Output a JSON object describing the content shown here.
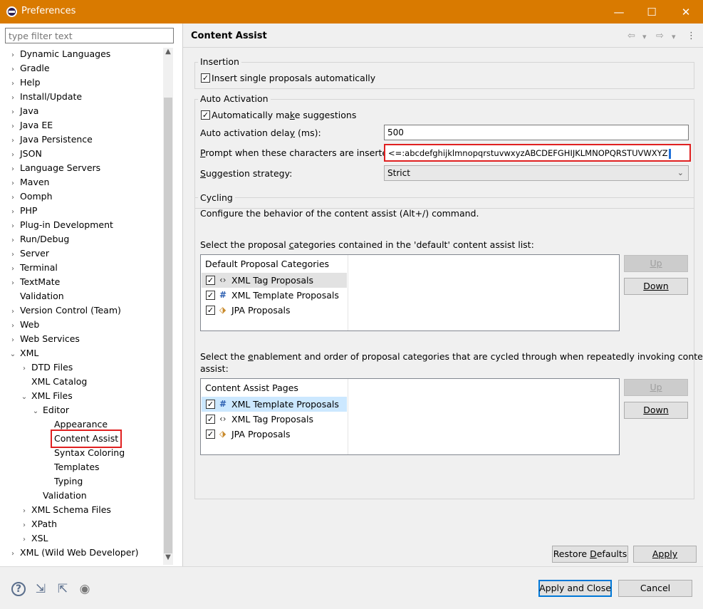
{
  "window": {
    "title": "Preferences",
    "controls": {
      "minimize": "—",
      "maximize": "☐",
      "close": "✕"
    }
  },
  "sidebar": {
    "filter_placeholder": "type filter text",
    "items": [
      {
        "label": "Dynamic Languages",
        "twisty": "›"
      },
      {
        "label": "Gradle",
        "twisty": "›"
      },
      {
        "label": "Help",
        "twisty": "›"
      },
      {
        "label": "Install/Update",
        "twisty": "›"
      },
      {
        "label": "Java",
        "twisty": "›"
      },
      {
        "label": "Java EE",
        "twisty": "›"
      },
      {
        "label": "Java Persistence",
        "twisty": "›"
      },
      {
        "label": "JSON",
        "twisty": "›"
      },
      {
        "label": "Language Servers",
        "twisty": "›"
      },
      {
        "label": "Maven",
        "twisty": "›"
      },
      {
        "label": "Oomph",
        "twisty": "›"
      },
      {
        "label": "PHP",
        "twisty": "›"
      },
      {
        "label": "Plug-in Development",
        "twisty": "›"
      },
      {
        "label": "Run/Debug",
        "twisty": "›"
      },
      {
        "label": "Server",
        "twisty": "›"
      },
      {
        "label": "Terminal",
        "twisty": "›"
      },
      {
        "label": "TextMate",
        "twisty": "›"
      },
      {
        "label": "Validation",
        "twisty": ""
      },
      {
        "label": "Version Control (Team)",
        "twisty": "›"
      },
      {
        "label": "Web",
        "twisty": "›"
      },
      {
        "label": "Web Services",
        "twisty": "›"
      },
      {
        "label": "XML",
        "twisty": "⌄"
      },
      {
        "label": "DTD Files",
        "twisty": "›"
      },
      {
        "label": "XML Catalog",
        "twisty": ""
      },
      {
        "label": "XML Files",
        "twisty": "⌄"
      },
      {
        "label": "Editor",
        "twisty": "⌄"
      },
      {
        "label": "Appearance",
        "twisty": ""
      },
      {
        "label": "Content Assist",
        "twisty": ""
      },
      {
        "label": "Syntax Coloring",
        "twisty": ""
      },
      {
        "label": "Templates",
        "twisty": ""
      },
      {
        "label": "Typing",
        "twisty": ""
      },
      {
        "label": "Validation",
        "twisty": ""
      },
      {
        "label": "XML Schema Files",
        "twisty": "›"
      },
      {
        "label": "XPath",
        "twisty": "›"
      },
      {
        "label": "XSL",
        "twisty": "›"
      },
      {
        "label": "XML (Wild Web Developer)",
        "twisty": "›"
      }
    ],
    "scroll_up": "▲",
    "scroll_down": "▼"
  },
  "page": {
    "title": "Content Assist",
    "nav": {
      "back": "⇦",
      "back_menu": "▾",
      "forward": "⇨",
      "forward_menu": "▾",
      "more": "⋮"
    },
    "insertion": {
      "group_label": "Insertion",
      "insert_single": {
        "label": "Insert single proposals automatically",
        "checked": "✓"
      }
    },
    "auto_activation": {
      "group_label": "Auto Activation",
      "make_suggestions": {
        "label_pre": "Automatically ma",
        "label_ul": "k",
        "label_post": "e suggestions",
        "checked": "✓"
      },
      "delay": {
        "label_pre": "Auto activation dela",
        "label_ul": "y",
        "label_post": " (ms):",
        "value": "500"
      },
      "prompt": {
        "label_pre": "",
        "label_ul": "P",
        "label_post": "rompt when these characters are inserted:",
        "value": "<=:abcdefghijklmnopqrstuvwxyzABCDEFGHIJKLMNOPQRSTUVWXYZ"
      },
      "strategy": {
        "label_pre": "",
        "label_ul": "S",
        "label_post": "uggestion strategy:",
        "value": "Strict",
        "arrow": "⌄"
      }
    },
    "cycling": {
      "group_label": "Cycling",
      "description": "Configure the behavior of the content assist (Alt+/) command.",
      "default_list_label_pre": "Select the proposal ",
      "default_list_label_ul": "c",
      "default_list_label_post": "ategories contained in the 'default' content assist list:",
      "default_list": {
        "header": "Default Proposal Categories",
        "rows": [
          {
            "icon": "‹›",
            "label": "XML Tag Proposals",
            "checked": "✓"
          },
          {
            "icon": "#",
            "label": "XML Template Proposals",
            "checked": "✓"
          },
          {
            "icon": "⬗",
            "label": "JPA Proposals",
            "checked": "✓"
          }
        ],
        "up": "Up",
        "down": "Down"
      },
      "cycle_list_label_line1_pre": "Select the ",
      "cycle_list_label_line1_ul": "e",
      "cycle_list_label_line1_post": "nablement and order of proposal categories that are cycled through when repeatedly invoking content",
      "cycle_list_label_line2": "assist:",
      "cycle_list": {
        "header": "Content Assist Pages",
        "rows": [
          {
            "icon": "#",
            "label": "XML Template Proposals",
            "checked": "✓"
          },
          {
            "icon": "‹›",
            "label": "XML Tag Proposals",
            "checked": "✓"
          },
          {
            "icon": "⬗",
            "label": "JPA Proposals",
            "checked": "✓"
          }
        ],
        "up": "Up",
        "down": "Down"
      }
    },
    "restore_defaults_pre": "Restore ",
    "restore_defaults_ul": "D",
    "restore_defaults_post": "efaults",
    "apply": "Apply"
  },
  "footer": {
    "icons": {
      "help": "?",
      "import": "⇲",
      "export": "⇱",
      "record": "◉"
    },
    "apply_and_close": "Apply and Close",
    "cancel": "Cancel"
  }
}
